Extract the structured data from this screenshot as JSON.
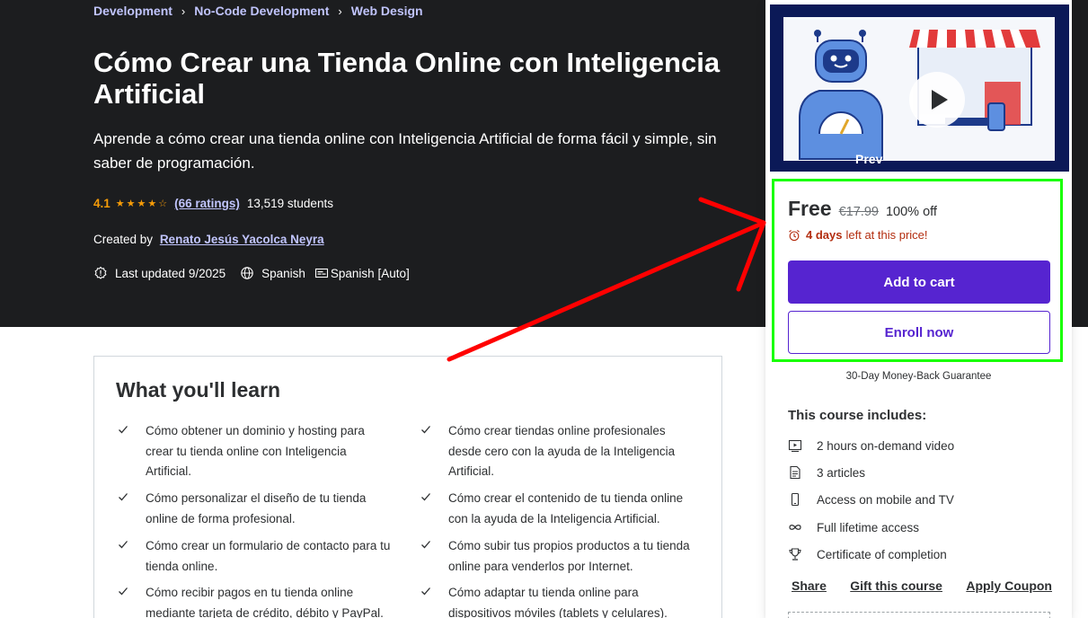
{
  "breadcrumb": [
    "Development",
    "No-Code Development",
    "Web Design"
  ],
  "course": {
    "title": "Cómo Crear una Tienda Online con Inteligencia Artificial",
    "subtitle": "Aprende a cómo crear una tienda online con Inteligencia Artificial de forma fácil y simple, sin saber de programación.",
    "rating": "4.1",
    "stars_filled": 4,
    "ratings_link": "(66 ratings)",
    "students": "13,519 students",
    "created_by_label": "Created by",
    "author": "Renato Jesús Yacolca Neyra",
    "last_updated": "Last updated 9/2025",
    "language": "Spanish",
    "captions": "Spanish [Auto]"
  },
  "learn": {
    "title": "What you'll learn",
    "items": [
      "Cómo obtener un dominio y hosting para crear tu tienda online con Inteligencia Artificial.",
      "Cómo crear tiendas online profesionales desde cero con la ayuda de la Inteligencia Artificial.",
      "Cómo personalizar el diseño de tu tienda online de forma profesional.",
      "Cómo crear el contenido de tu tienda online con la ayuda de la Inteligencia Artificial.",
      "Cómo crear un formulario de contacto para tu tienda online.",
      "Cómo subir tus propios productos a tu tienda online para venderlos por Internet.",
      "Cómo recibir pagos en tu tienda online mediante tarjeta de crédito, débito y PayPal.",
      "Cómo adaptar tu tienda online para dispositivos móviles (tablets y celulares)."
    ]
  },
  "sidebar": {
    "preview_label": "Prev",
    "price": "Free",
    "original_price": "€17.99",
    "discount": "100% off",
    "deal_days": "4 days",
    "deal_text": "left at this price!",
    "add_to_cart": "Add to cart",
    "enroll_now": "Enroll now",
    "guarantee": "30-Day Money-Back Guarantee",
    "includes_title": "This course includes:",
    "includes": [
      {
        "icon": "video-icon",
        "text": "2 hours on-demand video"
      },
      {
        "icon": "article-icon",
        "text": "3 articles"
      },
      {
        "icon": "mobile-icon",
        "text": "Access on mobile and TV"
      },
      {
        "icon": "infinity-icon",
        "text": "Full lifetime access"
      },
      {
        "icon": "trophy-icon",
        "text": "Certificate of completion"
      }
    ],
    "links": [
      "Share",
      "Gift this course",
      "Apply Coupon"
    ]
  },
  "colors": {
    "hero_bg": "#1c1d1f",
    "accent_purple": "#5624d0",
    "link_lavender": "#c0c4fc",
    "star_orange": "#f69c08",
    "deal_red": "#b32d0f",
    "highlight_green": "#19ff00",
    "annotation_red": "#ff0000"
  }
}
